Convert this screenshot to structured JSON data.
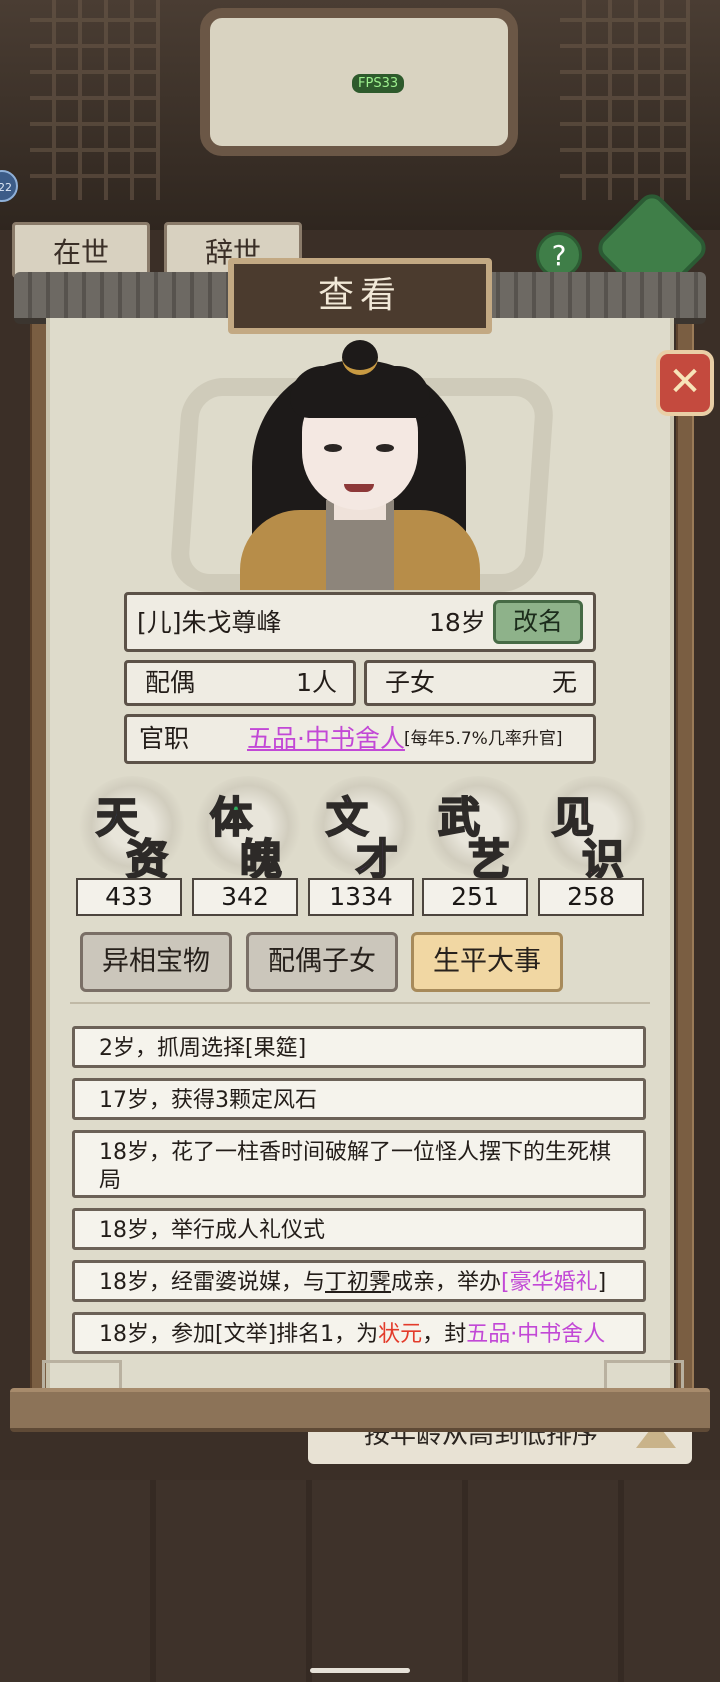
{
  "hud": {
    "fps": "FPS33",
    "badge": "22"
  },
  "background": {
    "tab_alive": "在世",
    "tab_dead": "辞世",
    "help": "?",
    "sort_label": "按年龄从高到低排序"
  },
  "modal": {
    "title": "查看",
    "close": "✕",
    "character": {
      "name": "[儿]朱戈尊峰",
      "age": "18岁",
      "rename": "改名"
    },
    "spouse": {
      "label": "配偶",
      "value": "1人"
    },
    "children": {
      "label": "子女",
      "value": "无"
    },
    "office": {
      "label": "官职",
      "value": "五品·中书舍人",
      "note": "[每年5.7%几率升官]"
    },
    "attributes": [
      {
        "line1": "天",
        "line2": "资",
        "value": "433",
        "color": "#4a7fe0"
      },
      {
        "line1": "体",
        "line2": "魄",
        "value": "342",
        "color": "#2fae5e"
      },
      {
        "line1": "文",
        "line2": "才",
        "value": "1334",
        "color": "#9a55d8"
      },
      {
        "line1": "武",
        "line2": "艺",
        "value": "251",
        "color": "#d99e2a"
      },
      {
        "line1": "见",
        "line2": "识",
        "value": "258",
        "color": "#e46f7c"
      }
    ],
    "tabs": {
      "treasures": "异相宝物",
      "family": "配偶子女",
      "events": "生平大事"
    },
    "events": {
      "e1": "2岁，抓周选择[果筵]",
      "e2": "17岁，获得3颗定风石",
      "e3": "18岁，花了一柱香时间破解了一位怪人摆下的生死棋局",
      "e4": "18岁，举行成人礼仪式",
      "e5": {
        "pre": "18岁，经雷婆说媒，与",
        "spouse": "丁初霁",
        "mid": "成亲，举办",
        "wedding": "[豪华婚礼",
        "end": "]"
      },
      "e6": {
        "pre": "18岁，参加[文举]排名1，为",
        "rank": "状元",
        "mid": "，封",
        "title": "五品·中书舍人"
      }
    }
  }
}
